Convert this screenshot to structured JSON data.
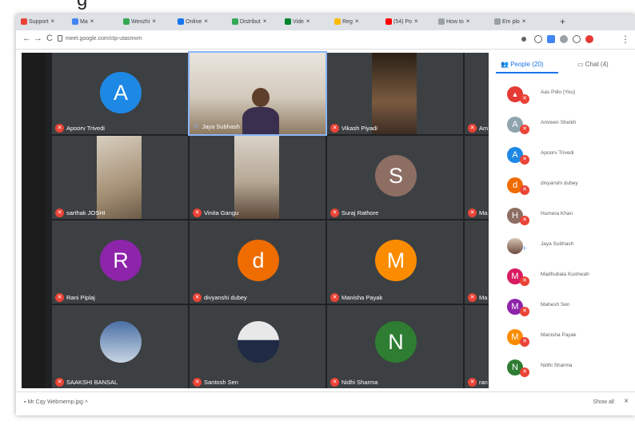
{
  "top_fragment": "g",
  "browser": {
    "tabs": [
      {
        "label": "Support",
        "icon_color": "#ea4335"
      },
      {
        "label": "Ma",
        "icon_color": "#4285f4"
      },
      {
        "label": "Wenzhi",
        "icon_color": "#34a853"
      },
      {
        "label": "Online",
        "icon_color": "#1877f2"
      },
      {
        "label": "Distribut",
        "icon_color": "#34a853"
      },
      {
        "label": "Vide",
        "icon_color": "#00832d"
      },
      {
        "label": "Reg",
        "icon_color": "#fbbc05"
      },
      {
        "label": "(54) Po",
        "icon_color": "#ff0000"
      },
      {
        "label": "How to",
        "icon_color": "#9aa0a6"
      },
      {
        "label": "Em plo",
        "icon_color": "#9aa0a6"
      }
    ],
    "new_tab": "+",
    "back": "←",
    "forward": "→",
    "reload": "C",
    "url": "meet.google.com/ctp-utasmvm",
    "menu": "⋮"
  },
  "participants": [
    {
      "name": "Apoorv Trivedi",
      "initial": "A",
      "color": "#1e88e5",
      "muted": true,
      "mic": "✕"
    },
    {
      "name": "Jaya Subhash",
      "speaking": "·ı|·"
    },
    {
      "name": "Vikash Piyadi",
      "muted": true,
      "mic": "✕"
    },
    {
      "name": "Am",
      "muted": true,
      "mic": "✕"
    },
    {
      "name": "sarthak JOSHI",
      "muted": true,
      "mic": "✕"
    },
    {
      "name": "Vinita Gangu",
      "muted": true,
      "mic": "✕"
    },
    {
      "name": "Suraj Rathore",
      "initial": "S",
      "color": "#8d6e63",
      "muted": true,
      "mic": "✕"
    },
    {
      "name": "Ma",
      "muted": true,
      "mic": "✕"
    },
    {
      "name": "Rani Piplaj",
      "initial": "R",
      "color": "#8e24aa",
      "muted": true,
      "mic": "✕"
    },
    {
      "name": "divyanshi dubey",
      "initial": "d",
      "color": "#ef6c00",
      "muted": true,
      "mic": "✕"
    },
    {
      "name": "Manisha Payak",
      "initial": "M",
      "color": "#fb8c00",
      "muted": true,
      "mic": "✕"
    },
    {
      "name": "Ma",
      "muted": true,
      "mic": "✕"
    },
    {
      "name": "SAAKSHI BANSAL",
      "muted": true,
      "mic": "✕"
    },
    {
      "name": "Santosh Sen",
      "muted": true,
      "mic": "✕"
    },
    {
      "name": "Nidhi Sharma",
      "initial": "N",
      "color": "#2e7d32",
      "muted": true,
      "mic": "✕"
    },
    {
      "name": "ran",
      "muted": true,
      "mic": "✕"
    }
  ],
  "sidebar": {
    "people_tab": "People (20)",
    "chat_tab": "Chat (4)",
    "people": [
      {
        "name": "Aas Pdio (You)",
        "initial": "▲",
        "color": "#e53935",
        "muted": true
      },
      {
        "name": "Amreen Sheikh",
        "initial": "A",
        "color": "#90a4ae",
        "muted": true
      },
      {
        "name": "Apoorv Trivedi",
        "initial": "A",
        "color": "#1e88e5",
        "muted": true
      },
      {
        "name": "divyanshi dubey",
        "initial": "d",
        "color": "#ef6c00",
        "muted": true
      },
      {
        "name": "Humera Khan",
        "initial": "H",
        "color": "#8d6e63",
        "muted": true
      },
      {
        "name": "Jaya Subhash",
        "initial": "",
        "color": "#b39ddb",
        "muted": false
      },
      {
        "name": "Madhubala Kushwah",
        "initial": "M",
        "color": "#d81b60",
        "muted": true
      },
      {
        "name": "Mahesh Sen",
        "initial": "M",
        "color": "#8e24aa",
        "muted": true
      },
      {
        "name": "Manisha Payak",
        "initial": "M",
        "color": "#fb8c00",
        "muted": true
      },
      {
        "name": "Nidhi Sharma",
        "initial": "N",
        "color": "#2e7d32",
        "muted": true
      }
    ]
  },
  "download": {
    "file": "Mr Cqy Webmemp.jpg",
    "show_all": "Show all"
  },
  "colors": {
    "mute_red": "#ea4335",
    "active_blue": "#1a73e8",
    "meet_bg": "#202124",
    "tile_bg": "#3c4043"
  }
}
